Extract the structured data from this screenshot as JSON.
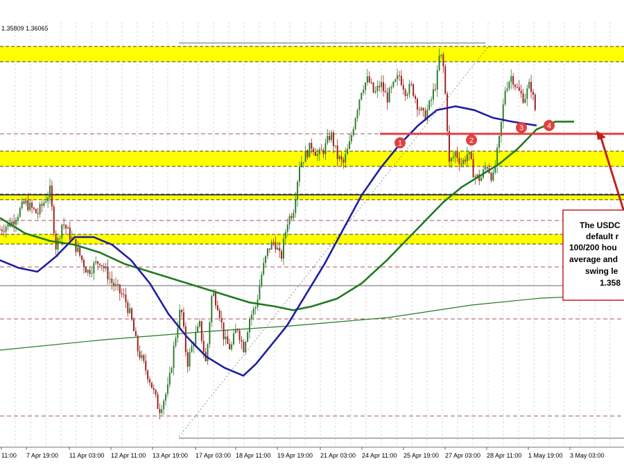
{
  "header": {
    "ohlc_text": "1.35809 1.36065"
  },
  "colors": {
    "zone": "#ffff00",
    "zone_border": "#000000",
    "candle_up": "#2f7d2f",
    "candle_down": "#a02020",
    "ma100": "#1e1ea0",
    "ma200": "#1f7a1f",
    "red_line": "#e04040",
    "marker": "#e04040",
    "grid": "#8b1a1a",
    "callout_border": "#c02020"
  },
  "annotation": {
    "lines": [
      "The USDC",
      "default r",
      "100/200 hou",
      "average and",
      "swing le",
      "1.358"
    ]
  },
  "markers": [
    {
      "label": "1"
    },
    {
      "label": "2"
    },
    {
      "label": "3"
    },
    {
      "label": "4"
    }
  ],
  "chart_data": {
    "type": "candlestick",
    "title": "",
    "xlabel": "",
    "ylabel": "",
    "x_tick_labels": [
      "11:00",
      "7 Apr 19:00",
      "11 Apr 03:00",
      "12 Apr 11:00",
      "13 Apr 19:00",
      "17 Apr 03:00",
      "18 Apr 11:00",
      "19 Apr 19:00",
      "21 Apr 03:00",
      "24 Apr 11:00",
      "25 Apr 19:00",
      "27 Apr 03:00",
      "28 Apr 11:00",
      "1 May 19:00",
      "3 May 03:00"
    ],
    "close_path": [
      [
        0,
        0.53
      ],
      [
        0.02,
        0.55
      ],
      [
        0.04,
        0.6
      ],
      [
        0.06,
        0.57
      ],
      [
        0.08,
        0.63
      ],
      [
        0.09,
        0.48
      ],
      [
        0.1,
        0.55
      ],
      [
        0.12,
        0.49
      ],
      [
        0.14,
        0.42
      ],
      [
        0.16,
        0.45
      ],
      [
        0.18,
        0.39
      ],
      [
        0.2,
        0.35
      ],
      [
        0.21,
        0.3
      ],
      [
        0.22,
        0.22
      ],
      [
        0.24,
        0.14
      ],
      [
        0.255,
        0.06
      ],
      [
        0.27,
        0.12
      ],
      [
        0.28,
        0.24
      ],
      [
        0.29,
        0.33
      ],
      [
        0.3,
        0.18
      ],
      [
        0.31,
        0.24
      ],
      [
        0.32,
        0.28
      ],
      [
        0.33,
        0.18
      ],
      [
        0.34,
        0.37
      ],
      [
        0.35,
        0.33
      ],
      [
        0.36,
        0.24
      ],
      [
        0.37,
        0.22
      ],
      [
        0.38,
        0.28
      ],
      [
        0.39,
        0.22
      ],
      [
        0.4,
        0.3
      ],
      [
        0.41,
        0.33
      ],
      [
        0.42,
        0.42
      ],
      [
        0.43,
        0.48
      ],
      [
        0.44,
        0.5
      ],
      [
        0.45,
        0.45
      ],
      [
        0.46,
        0.55
      ],
      [
        0.47,
        0.58
      ],
      [
        0.48,
        0.7
      ],
      [
        0.5,
        0.75
      ],
      [
        0.51,
        0.72
      ],
      [
        0.52,
        0.74
      ],
      [
        0.53,
        0.78
      ],
      [
        0.54,
        0.72
      ],
      [
        0.55,
        0.7
      ],
      [
        0.56,
        0.75
      ],
      [
        0.57,
        0.83
      ],
      [
        0.58,
        0.9
      ],
      [
        0.59,
        0.92
      ],
      [
        0.6,
        0.88
      ],
      [
        0.61,
        0.91
      ],
      [
        0.62,
        0.87
      ],
      [
        0.63,
        0.9
      ],
      [
        0.64,
        0.93
      ],
      [
        0.65,
        0.89
      ],
      [
        0.66,
        0.9
      ],
      [
        0.67,
        0.85
      ],
      [
        0.68,
        0.82
      ],
      [
        0.69,
        0.86
      ],
      [
        0.7,
        0.92
      ],
      [
        0.705,
        0.99
      ],
      [
        0.71,
        0.96
      ],
      [
        0.715,
        0.85
      ],
      [
        0.72,
        0.7
      ],
      [
        0.73,
        0.73
      ],
      [
        0.74,
        0.7
      ],
      [
        0.75,
        0.73
      ],
      [
        0.76,
        0.67
      ],
      [
        0.77,
        0.66
      ],
      [
        0.78,
        0.7
      ],
      [
        0.79,
        0.66
      ],
      [
        0.8,
        0.76
      ],
      [
        0.81,
        0.9
      ],
      [
        0.82,
        0.93
      ],
      [
        0.83,
        0.89
      ],
      [
        0.84,
        0.87
      ],
      [
        0.85,
        0.91
      ],
      [
        0.86,
        0.82
      ]
    ],
    "ma100_path": [
      [
        0,
        0.45
      ],
      [
        0.03,
        0.43
      ],
      [
        0.06,
        0.42
      ],
      [
        0.09,
        0.46
      ],
      [
        0.12,
        0.51
      ],
      [
        0.15,
        0.51
      ],
      [
        0.18,
        0.49
      ],
      [
        0.21,
        0.45
      ],
      [
        0.24,
        0.39
      ],
      [
        0.27,
        0.31
      ],
      [
        0.3,
        0.25
      ],
      [
        0.33,
        0.2
      ],
      [
        0.36,
        0.17
      ],
      [
        0.39,
        0.15
      ],
      [
        0.41,
        0.18
      ],
      [
        0.43,
        0.22
      ],
      [
        0.46,
        0.28
      ],
      [
        0.49,
        0.36
      ],
      [
        0.52,
        0.44
      ],
      [
        0.55,
        0.53
      ],
      [
        0.58,
        0.62
      ],
      [
        0.61,
        0.69
      ],
      [
        0.64,
        0.75
      ],
      [
        0.67,
        0.8
      ],
      [
        0.7,
        0.84
      ],
      [
        0.73,
        0.85
      ],
      [
        0.76,
        0.84
      ],
      [
        0.79,
        0.82
      ],
      [
        0.82,
        0.81
      ],
      [
        0.86,
        0.8
      ]
    ],
    "ma200_path": [
      [
        0,
        0.56
      ],
      [
        0.04,
        0.52
      ],
      [
        0.08,
        0.5
      ],
      [
        0.12,
        0.49
      ],
      [
        0.16,
        0.47
      ],
      [
        0.2,
        0.44
      ],
      [
        0.24,
        0.42
      ],
      [
        0.28,
        0.4
      ],
      [
        0.32,
        0.38
      ],
      [
        0.36,
        0.36
      ],
      [
        0.4,
        0.34
      ],
      [
        0.44,
        0.33
      ],
      [
        0.47,
        0.32
      ],
      [
        0.5,
        0.33
      ],
      [
        0.54,
        0.35
      ],
      [
        0.58,
        0.39
      ],
      [
        0.62,
        0.45
      ],
      [
        0.65,
        0.5
      ],
      [
        0.68,
        0.55
      ],
      [
        0.71,
        0.6
      ],
      [
        0.74,
        0.64
      ],
      [
        0.77,
        0.67
      ],
      [
        0.8,
        0.7
      ],
      [
        0.83,
        0.74
      ],
      [
        0.86,
        0.79
      ],
      [
        0.89,
        0.81
      ],
      [
        0.92,
        0.81
      ]
    ]
  }
}
